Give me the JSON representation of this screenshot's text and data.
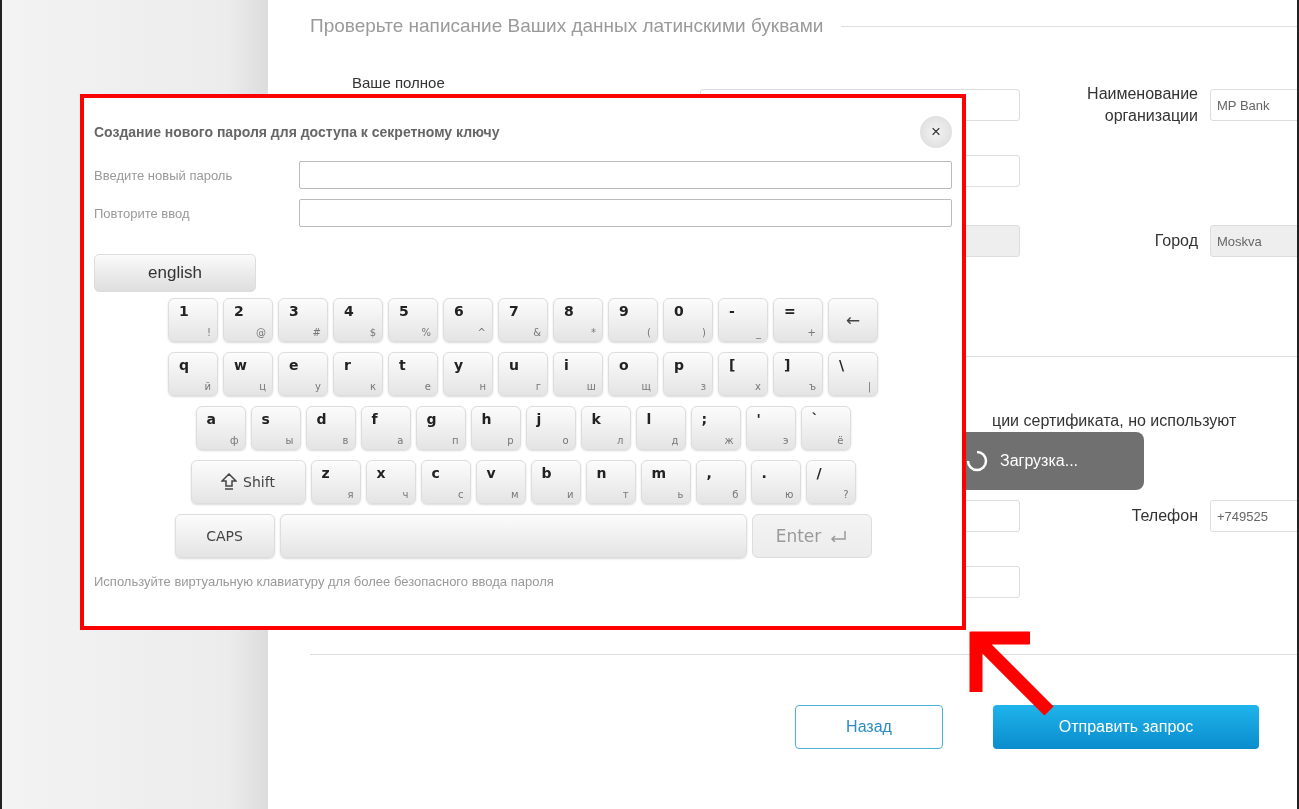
{
  "page": {
    "title": "Проверьте написание Ваших данных латинскими буквами"
  },
  "form_rows": [
    {
      "left": {
        "label": "Ваше полное",
        "disabled": false
      },
      "right": {
        "label": "Наименование организации",
        "value": "MP Bank",
        "disabled": false
      }
    },
    {
      "left": {
        "disabled": false
      }
    },
    {
      "left": {
        "disabled": true
      },
      "right": {
        "label": "Город",
        "value": "Moskva",
        "disabled": true
      }
    }
  ],
  "note": "ции сертификата, но используют",
  "form_rows_2": [
    {
      "left": {
        "disabled": false
      },
      "right": {
        "label": "Телефон",
        "value": "+749525",
        "disabled": false
      }
    },
    {
      "left": {
        "disabled": false
      }
    }
  ],
  "buttons": [
    {
      "label": "Назад",
      "kind": "secondary"
    },
    {
      "label": "Отправить запрос",
      "kind": "primary"
    }
  ],
  "toast": {
    "text": "Загрузка..."
  },
  "modal": {
    "title": "Создание нового пароля для доступа к секретному ключу",
    "close": "×",
    "fields": [
      {
        "label": "Введите новый пароль"
      },
      {
        "label": "Повторите ввод"
      }
    ],
    "language_button": "english",
    "keyboard": [
      [
        {
          "kind": "char",
          "main": "1",
          "sub": "!"
        },
        {
          "kind": "char",
          "main": "2",
          "sub": "@"
        },
        {
          "kind": "char",
          "main": "3",
          "sub": "#"
        },
        {
          "kind": "char",
          "main": "4",
          "sub": "$"
        },
        {
          "kind": "char",
          "main": "5",
          "sub": "%"
        },
        {
          "kind": "char",
          "main": "6",
          "sub": "^"
        },
        {
          "kind": "char",
          "main": "7",
          "sub": "&"
        },
        {
          "kind": "char",
          "main": "8",
          "sub": "*"
        },
        {
          "kind": "char",
          "main": "9",
          "sub": "("
        },
        {
          "kind": "char",
          "main": "0",
          "sub": ")"
        },
        {
          "kind": "char",
          "main": "-",
          "sub": "_"
        },
        {
          "kind": "char",
          "main": "=",
          "sub": "+"
        },
        {
          "kind": "backspace",
          "main": "←"
        }
      ],
      [
        {
          "kind": "char",
          "main": "q",
          "sub": "й"
        },
        {
          "kind": "char",
          "main": "w",
          "sub": "ц"
        },
        {
          "kind": "char",
          "main": "e",
          "sub": "у"
        },
        {
          "kind": "char",
          "main": "r",
          "sub": "к"
        },
        {
          "kind": "char",
          "main": "t",
          "sub": "е"
        },
        {
          "kind": "char",
          "main": "y",
          "sub": "н"
        },
        {
          "kind": "char",
          "main": "u",
          "sub": "г"
        },
        {
          "kind": "char",
          "main": "i",
          "sub": "ш"
        },
        {
          "kind": "char",
          "main": "o",
          "sub": "щ"
        },
        {
          "kind": "char",
          "main": "p",
          "sub": "з"
        },
        {
          "kind": "char",
          "main": "[",
          "sub": "х"
        },
        {
          "kind": "char",
          "main": "]",
          "sub": "ъ"
        },
        {
          "kind": "char",
          "main": "\\",
          "sub": "|"
        }
      ],
      [
        {
          "kind": "char",
          "main": "a",
          "sub": "ф"
        },
        {
          "kind": "char",
          "main": "s",
          "sub": "ы"
        },
        {
          "kind": "char",
          "main": "d",
          "sub": "в"
        },
        {
          "kind": "char",
          "main": "f",
          "sub": "а"
        },
        {
          "kind": "char",
          "main": "g",
          "sub": "п"
        },
        {
          "kind": "char",
          "main": "h",
          "sub": "р"
        },
        {
          "kind": "char",
          "main": "j",
          "sub": "о"
        },
        {
          "kind": "char",
          "main": "k",
          "sub": "л"
        },
        {
          "kind": "char",
          "main": "l",
          "sub": "д"
        },
        {
          "kind": "char",
          "main": ";",
          "sub": "ж"
        },
        {
          "kind": "char",
          "main": "'",
          "sub": "э"
        },
        {
          "kind": "char",
          "main": "`",
          "sub": "ё"
        }
      ],
      [
        {
          "kind": "shift",
          "main": "Shift"
        },
        {
          "kind": "char",
          "main": "z",
          "sub": "я"
        },
        {
          "kind": "char",
          "main": "x",
          "sub": "ч"
        },
        {
          "kind": "char",
          "main": "c",
          "sub": "с"
        },
        {
          "kind": "char",
          "main": "v",
          "sub": "м"
        },
        {
          "kind": "char",
          "main": "b",
          "sub": "и"
        },
        {
          "kind": "char",
          "main": "n",
          "sub": "т"
        },
        {
          "kind": "char",
          "main": "m",
          "sub": "ь"
        },
        {
          "kind": "char",
          "main": ",",
          "sub": "б"
        },
        {
          "kind": "char",
          "main": ".",
          "sub": "ю"
        },
        {
          "kind": "char",
          "main": "/",
          "sub": "?"
        }
      ],
      [
        {
          "kind": "caps",
          "main": "CAPS",
          "disabled": false
        },
        {
          "kind": "space",
          "disabled": false
        },
        {
          "kind": "enter",
          "main": "Enter",
          "disabled": true
        }
      ]
    ],
    "hint": "Используйте виртуальную клавиатуру для более безопасного ввода пароля"
  }
}
